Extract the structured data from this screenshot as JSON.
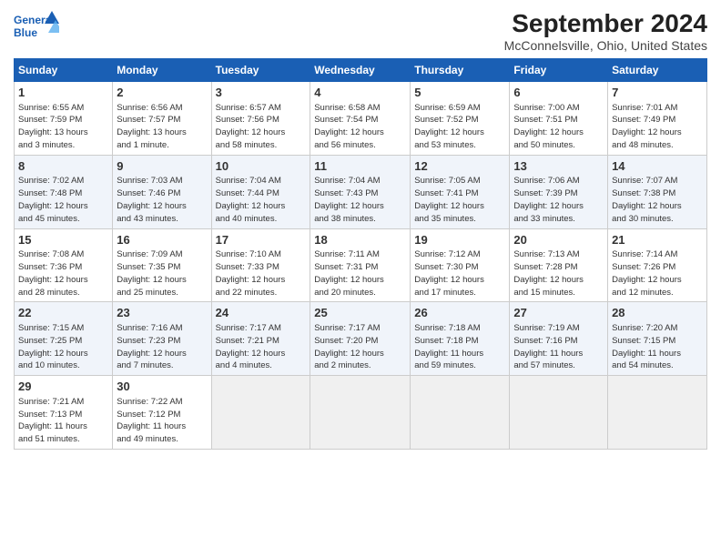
{
  "header": {
    "logo_line1": "General",
    "logo_line2": "Blue",
    "title": "September 2024",
    "subtitle": "McConnelsville, Ohio, United States"
  },
  "days_of_week": [
    "Sunday",
    "Monday",
    "Tuesday",
    "Wednesday",
    "Thursday",
    "Friday",
    "Saturday"
  ],
  "weeks": [
    [
      {
        "day": "1",
        "info": "Sunrise: 6:55 AM\nSunset: 7:59 PM\nDaylight: 13 hours\nand 3 minutes."
      },
      {
        "day": "2",
        "info": "Sunrise: 6:56 AM\nSunset: 7:57 PM\nDaylight: 13 hours\nand 1 minute."
      },
      {
        "day": "3",
        "info": "Sunrise: 6:57 AM\nSunset: 7:56 PM\nDaylight: 12 hours\nand 58 minutes."
      },
      {
        "day": "4",
        "info": "Sunrise: 6:58 AM\nSunset: 7:54 PM\nDaylight: 12 hours\nand 56 minutes."
      },
      {
        "day": "5",
        "info": "Sunrise: 6:59 AM\nSunset: 7:52 PM\nDaylight: 12 hours\nand 53 minutes."
      },
      {
        "day": "6",
        "info": "Sunrise: 7:00 AM\nSunset: 7:51 PM\nDaylight: 12 hours\nand 50 minutes."
      },
      {
        "day": "7",
        "info": "Sunrise: 7:01 AM\nSunset: 7:49 PM\nDaylight: 12 hours\nand 48 minutes."
      }
    ],
    [
      {
        "day": "8",
        "info": "Sunrise: 7:02 AM\nSunset: 7:48 PM\nDaylight: 12 hours\nand 45 minutes."
      },
      {
        "day": "9",
        "info": "Sunrise: 7:03 AM\nSunset: 7:46 PM\nDaylight: 12 hours\nand 43 minutes."
      },
      {
        "day": "10",
        "info": "Sunrise: 7:04 AM\nSunset: 7:44 PM\nDaylight: 12 hours\nand 40 minutes."
      },
      {
        "day": "11",
        "info": "Sunrise: 7:04 AM\nSunset: 7:43 PM\nDaylight: 12 hours\nand 38 minutes."
      },
      {
        "day": "12",
        "info": "Sunrise: 7:05 AM\nSunset: 7:41 PM\nDaylight: 12 hours\nand 35 minutes."
      },
      {
        "day": "13",
        "info": "Sunrise: 7:06 AM\nSunset: 7:39 PM\nDaylight: 12 hours\nand 33 minutes."
      },
      {
        "day": "14",
        "info": "Sunrise: 7:07 AM\nSunset: 7:38 PM\nDaylight: 12 hours\nand 30 minutes."
      }
    ],
    [
      {
        "day": "15",
        "info": "Sunrise: 7:08 AM\nSunset: 7:36 PM\nDaylight: 12 hours\nand 28 minutes."
      },
      {
        "day": "16",
        "info": "Sunrise: 7:09 AM\nSunset: 7:35 PM\nDaylight: 12 hours\nand 25 minutes."
      },
      {
        "day": "17",
        "info": "Sunrise: 7:10 AM\nSunset: 7:33 PM\nDaylight: 12 hours\nand 22 minutes."
      },
      {
        "day": "18",
        "info": "Sunrise: 7:11 AM\nSunset: 7:31 PM\nDaylight: 12 hours\nand 20 minutes."
      },
      {
        "day": "19",
        "info": "Sunrise: 7:12 AM\nSunset: 7:30 PM\nDaylight: 12 hours\nand 17 minutes."
      },
      {
        "day": "20",
        "info": "Sunrise: 7:13 AM\nSunset: 7:28 PM\nDaylight: 12 hours\nand 15 minutes."
      },
      {
        "day": "21",
        "info": "Sunrise: 7:14 AM\nSunset: 7:26 PM\nDaylight: 12 hours\nand 12 minutes."
      }
    ],
    [
      {
        "day": "22",
        "info": "Sunrise: 7:15 AM\nSunset: 7:25 PM\nDaylight: 12 hours\nand 10 minutes."
      },
      {
        "day": "23",
        "info": "Sunrise: 7:16 AM\nSunset: 7:23 PM\nDaylight: 12 hours\nand 7 minutes."
      },
      {
        "day": "24",
        "info": "Sunrise: 7:17 AM\nSunset: 7:21 PM\nDaylight: 12 hours\nand 4 minutes."
      },
      {
        "day": "25",
        "info": "Sunrise: 7:17 AM\nSunset: 7:20 PM\nDaylight: 12 hours\nand 2 minutes."
      },
      {
        "day": "26",
        "info": "Sunrise: 7:18 AM\nSunset: 7:18 PM\nDaylight: 11 hours\nand 59 minutes."
      },
      {
        "day": "27",
        "info": "Sunrise: 7:19 AM\nSunset: 7:16 PM\nDaylight: 11 hours\nand 57 minutes."
      },
      {
        "day": "28",
        "info": "Sunrise: 7:20 AM\nSunset: 7:15 PM\nDaylight: 11 hours\nand 54 minutes."
      }
    ],
    [
      {
        "day": "29",
        "info": "Sunrise: 7:21 AM\nSunset: 7:13 PM\nDaylight: 11 hours\nand 51 minutes."
      },
      {
        "day": "30",
        "info": "Sunrise: 7:22 AM\nSunset: 7:12 PM\nDaylight: 11 hours\nand 49 minutes."
      },
      {
        "day": "",
        "info": ""
      },
      {
        "day": "",
        "info": ""
      },
      {
        "day": "",
        "info": ""
      },
      {
        "day": "",
        "info": ""
      },
      {
        "day": "",
        "info": ""
      }
    ]
  ]
}
